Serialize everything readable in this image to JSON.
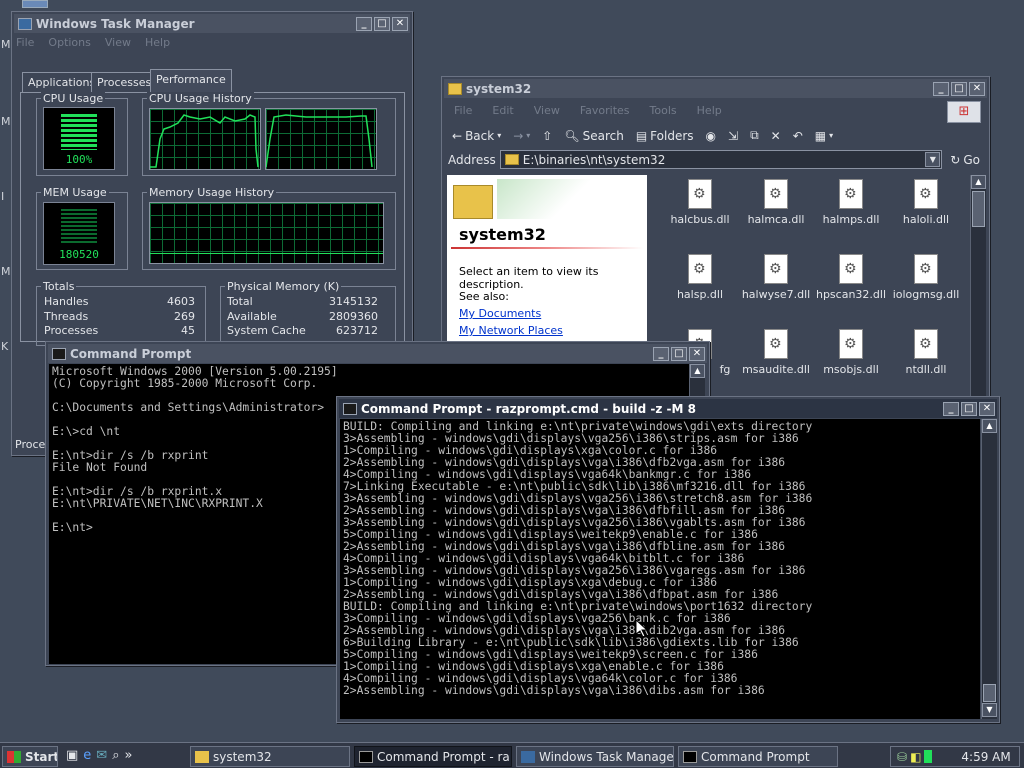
{
  "desktop": {
    "side_letters": [
      "M",
      "M",
      "I",
      "M",
      "K"
    ]
  },
  "taskmgr": {
    "title": "Windows Task Manager",
    "menu": [
      "File",
      "Options",
      "View",
      "Help"
    ],
    "tabs": [
      "Applications",
      "Processes",
      "Performance"
    ],
    "cpu_usage_label": "CPU Usage",
    "cpu_value": "100%",
    "cpu_history_label": "CPU Usage History",
    "mem_usage_label": "MEM Usage",
    "mem_value": "180520",
    "mem_history_label": "Memory Usage History",
    "totals": {
      "label": "Totals",
      "rows": [
        {
          "label": "Handles",
          "value": "4603"
        },
        {
          "label": "Threads",
          "value": "269"
        },
        {
          "label": "Processes",
          "value": "45"
        }
      ]
    },
    "physical": {
      "label": "Physical Memory (K)",
      "rows": [
        {
          "label": "Total",
          "value": "3145132"
        },
        {
          "label": "Available",
          "value": "2809360"
        },
        {
          "label": "System Cache",
          "value": "623712"
        }
      ]
    },
    "status_partial": "Proce"
  },
  "explorer": {
    "title": "system32",
    "menu": [
      "File",
      "Edit",
      "View",
      "Favorites",
      "Tools",
      "Help"
    ],
    "toolbar": {
      "back": "Back",
      "search": "Search",
      "folders": "Folders"
    },
    "address_label": "Address",
    "address_value": "E:\\binaries\\nt\\system32",
    "go": "Go",
    "panel": {
      "heading": "system32",
      "desc": "Select an item to view its description.",
      "see_also": "See also:",
      "links": [
        "My Documents",
        "My Network Places"
      ]
    },
    "files": [
      "halcbus.dll",
      "halmca.dll",
      "halmps.dll",
      "haloli.dll",
      "halsp.dll",
      "halwyse7.dll",
      "hpscan32.dll",
      "iologmsg.dll",
      "fg",
      "msaudite.dll",
      "msobjs.dll",
      "ntdll.dll"
    ]
  },
  "cmd1": {
    "title": "Command Prompt",
    "lines": [
      "Microsoft Windows 2000 [Version 5.00.2195]",
      "(C) Copyright 1985-2000 Microsoft Corp.",
      "",
      "C:\\Documents and Settings\\Administrator>",
      "",
      "E:\\>cd \\nt",
      "",
      "E:\\nt>dir /s /b rxprint",
      "File Not Found",
      "",
      "E:\\nt>dir /s /b rxprint.x",
      "E:\\nt\\PRIVATE\\NET\\INC\\RXPRINT.X",
      "",
      "E:\\nt>"
    ]
  },
  "cmd2": {
    "title": "Command Prompt - razprompt.cmd - build -z -M 8",
    "lines": [
      "BUILD: Compiling and linking e:\\nt\\private\\windows\\gdi\\exts directory",
      "3>Assembling - windows\\gdi\\displays\\vga256\\i386\\strips.asm for i386",
      "1>Compiling - windows\\gdi\\displays\\xga\\color.c for i386",
      "2>Assembling - windows\\gdi\\displays\\vga\\i386\\dfb2vga.asm for i386",
      "4>Compiling - windows\\gdi\\displays\\vga64k\\bankmgr.c for i386",
      "7>Linking Executable - e:\\nt\\public\\sdk\\lib\\i386\\mf3216.dll for i386",
      "3>Assembling - windows\\gdi\\displays\\vga256\\i386\\stretch8.asm for i386",
      "2>Assembling - windows\\gdi\\displays\\vga\\i386\\dfbfill.asm for i386",
      "3>Assembling - windows\\gdi\\displays\\vga256\\i386\\vgablts.asm for i386",
      "5>Compiling - windows\\gdi\\displays\\weitekp9\\enable.c for i386",
      "2>Assembling - windows\\gdi\\displays\\vga\\i386\\dfbline.asm for i386",
      "4>Compiling - windows\\gdi\\displays\\vga64k\\bitblt.c for i386",
      "3>Assembling - windows\\gdi\\displays\\vga256\\i386\\vgaregs.asm for i386",
      "1>Compiling - windows\\gdi\\displays\\xga\\debug.c for i386",
      "2>Assembling - windows\\gdi\\displays\\vga\\i386\\dfbpat.asm for i386",
      "BUILD: Compiling and linking e:\\nt\\private\\windows\\port1632 directory",
      "3>Compiling - windows\\gdi\\displays\\vga256\\bank.c for i386",
      "2>Assembling - windows\\gdi\\displays\\vga\\i386\\dib2vga.asm for i386",
      "6>Building Library - e:\\nt\\public\\sdk\\lib\\i386\\gdiexts.lib for i386",
      "5>Compiling - windows\\gdi\\displays\\weitekp9\\screen.c for i386",
      "1>Compiling - windows\\gdi\\displays\\xga\\enable.c for i386",
      "4>Compiling - windows\\gdi\\displays\\vga64k\\color.c for i386",
      "2>Assembling - windows\\gdi\\displays\\vga\\i386\\dibs.asm for i386",
      "",
      "_"
    ]
  },
  "taskbar": {
    "start": "Start",
    "tasks": [
      "system32",
      "Command Prompt - ra...",
      "Windows Task Manager",
      "Command Prompt"
    ],
    "clock": "4:59 AM"
  },
  "colors": {
    "graph_green": "#21e05a",
    "grid_green": "#0d6a35",
    "active_title": "#2c3444"
  }
}
